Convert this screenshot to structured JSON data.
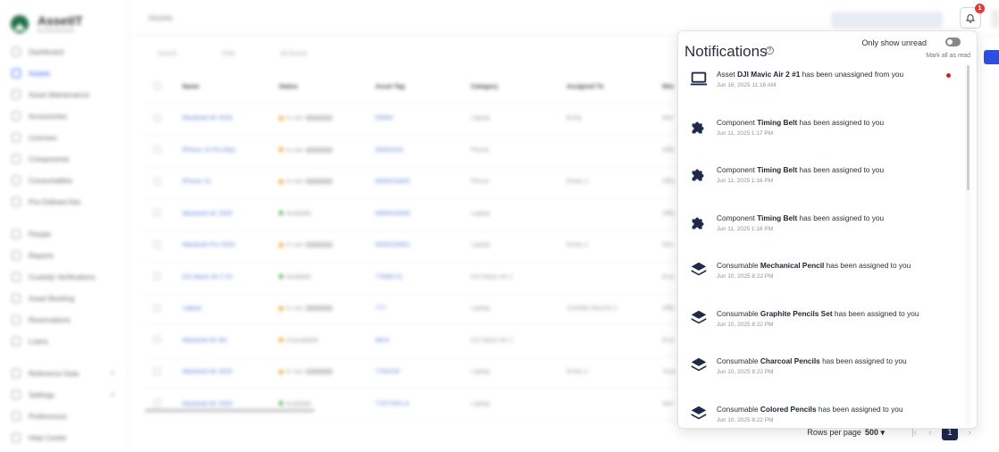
{
  "app": {
    "name": "AssetIT",
    "tagline": "by DevSamurai"
  },
  "sidebar": {
    "items": [
      {
        "label": "Dashboard",
        "active": false
      },
      {
        "label": "Assets",
        "active": true
      },
      {
        "label": "Asset Maintenance",
        "active": false
      },
      {
        "label": "Accessories",
        "active": false
      },
      {
        "label": "Licenses",
        "active": false
      },
      {
        "label": "Components",
        "active": false
      },
      {
        "label": "Consumables",
        "active": false
      },
      {
        "label": "Pre-Defined Kits",
        "active": false
      },
      {
        "label": "People",
        "active": false
      },
      {
        "label": "Reports",
        "active": false
      },
      {
        "label": "Custody Verifications",
        "active": false
      },
      {
        "label": "Asset Booking",
        "active": false
      },
      {
        "label": "Reservations",
        "active": false
      },
      {
        "label": "Loans",
        "active": false
      },
      {
        "label": "Reference Data",
        "active": false
      },
      {
        "label": "Settings",
        "active": false
      },
      {
        "label": "Preferences",
        "active": false
      },
      {
        "label": "Help Center",
        "active": false
      }
    ]
  },
  "header": {
    "title": "Assets"
  },
  "toolbar": {
    "search_placeholder": "Search",
    "filter_label": "Filter",
    "all_assets_label": "All Assets"
  },
  "table": {
    "columns": [
      "Name",
      "Status",
      "Asset Tag",
      "Category",
      "Assigned To",
      "Wor"
    ],
    "rows": [
      {
        "name": "Macbook Air 2018",
        "status": "In use",
        "status_color": "#f0a020",
        "tag": "00000",
        "category": "Laptop",
        "assigned": "Emily",
        "extra": "Wor"
      },
      {
        "name": "iPhone 15 Pro Max",
        "status": "In use",
        "status_color": "#f0a020",
        "tag": "00000103",
        "category": "Phone",
        "assigned": "",
        "extra": "Offic"
      },
      {
        "name": "iPhone 14",
        "status": "In use",
        "status_color": "#f0a020",
        "tag": "0000016002",
        "category": "Phone",
        "assigned": "Emily Li",
        "extra": "Offic"
      },
      {
        "name": "Macbook Air 2020",
        "status": "Available",
        "status_color": "#4caf50",
        "tag": "0000016000",
        "category": "Laptop",
        "assigned": "",
        "extra": "Offic"
      },
      {
        "name": "Macbook Pro 2020",
        "status": "In use",
        "status_color": "#f0a020",
        "tag": "0000016001",
        "category": "Laptop",
        "assigned": "Emily Li",
        "extra": "Wor"
      },
      {
        "name": "DJI Mavic Air 2 #1",
        "status": "Available",
        "status_color": "#4caf50",
        "tag": "77698711",
        "category": "DJI Mavic Air 2",
        "assigned": "",
        "extra": "Envi"
      },
      {
        "name": "Laptop",
        "status": "In use",
        "status_color": "#f0a020",
        "tag": "777",
        "category": "Laptop",
        "assigned": "Yoshida Haruchi 2",
        "extra": "Offic"
      },
      {
        "name": "Macbook Air M2",
        "status": "Unavailable",
        "status_color": "#f0a020",
        "tag": "8814",
        "category": "DJI Mavic Air 2",
        "assigned": "",
        "extra": "Envi"
      },
      {
        "name": "Macbook Air 2020",
        "status": "In use",
        "status_color": "#f0a020",
        "tag": "7700100",
        "category": "Laptop",
        "assigned": "Emily Li",
        "extra": "Yoss"
      },
      {
        "name": "Macbook Air 2020",
        "status": "Available",
        "status_color": "#4caf50",
        "tag": "77977001-A",
        "category": "Laptop",
        "assigned": "",
        "extra": "Wor"
      }
    ]
  },
  "pagination": {
    "rows_label": "Rows per page",
    "rows_value": "500 ▾",
    "current_page": "1",
    "first": "|‹",
    "prev": "‹",
    "next": "›"
  },
  "notifications": {
    "badge_count": "1",
    "title": "Notifications",
    "help_glyph": "?",
    "only_unread_label": "Only show unread",
    "mark_all_label": "Mark all as read",
    "items": [
      {
        "icon": "laptop-icon",
        "prefix": "Asset ",
        "bold": "DJI Mavic Air 2 #1",
        "suffix": " has been unassigned from you",
        "time": "Jun 16, 2025 11:16 AM",
        "unread": true
      },
      {
        "icon": "puzzle-icon",
        "prefix": "Component ",
        "bold": "Timing Belt",
        "suffix": " has been assigned to you",
        "time": "Jun 11, 2025 1:17 PM",
        "unread": false
      },
      {
        "icon": "puzzle-icon",
        "prefix": "Component ",
        "bold": "Timing Belt",
        "suffix": " has been assigned to you",
        "time": "Jun 11, 2025 1:16 PM",
        "unread": false
      },
      {
        "icon": "puzzle-icon",
        "prefix": "Component ",
        "bold": "Timing Belt",
        "suffix": " has been assigned to you",
        "time": "Jun 11, 2025 1:16 PM",
        "unread": false
      },
      {
        "icon": "layers-icon",
        "prefix": "Consumable ",
        "bold": "Mechanical Pencil",
        "suffix": " has been assigned to you",
        "time": "Jun 10, 2025 8:22 PM",
        "unread": false
      },
      {
        "icon": "layers-icon",
        "prefix": "Consumable ",
        "bold": "Graphite Pencils Set",
        "suffix": " has been assigned to you",
        "time": "Jun 10, 2025 8:22 PM",
        "unread": false
      },
      {
        "icon": "layers-icon",
        "prefix": "Consumable ",
        "bold": "Charcoal Pencils",
        "suffix": " has been assigned to you",
        "time": "Jun 10, 2025 8:22 PM",
        "unread": false
      },
      {
        "icon": "layers-icon",
        "prefix": "Consumable ",
        "bold": "Colored Pencils",
        "suffix": " has been assigned to you",
        "time": "Jun 10, 2025 8:22 PM",
        "unread": false
      }
    ]
  }
}
